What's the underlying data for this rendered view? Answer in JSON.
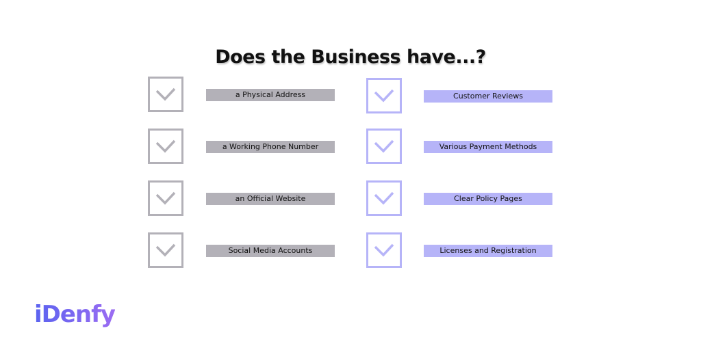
{
  "title": "Does the Business have...?",
  "colors": {
    "grey": "#b3b1b8",
    "purple": "#b6b4f8",
    "logo_start": "#5b63f0",
    "logo_end": "#9b6cf2"
  },
  "left_column": [
    {
      "label": "a Physical Address",
      "checked": true
    },
    {
      "label": "a Working Phone Number",
      "checked": true
    },
    {
      "label": "an Official Website",
      "checked": true
    },
    {
      "label": "Social Media Accounts",
      "checked": true
    }
  ],
  "right_column": [
    {
      "label": "Customer Reviews",
      "checked": true
    },
    {
      "label": "Various Payment Methods",
      "checked": true
    },
    {
      "label": "Clear Policy Pages",
      "checked": true
    },
    {
      "label": "Licenses and Registration",
      "checked": true
    }
  ],
  "logo": "iDenfy"
}
